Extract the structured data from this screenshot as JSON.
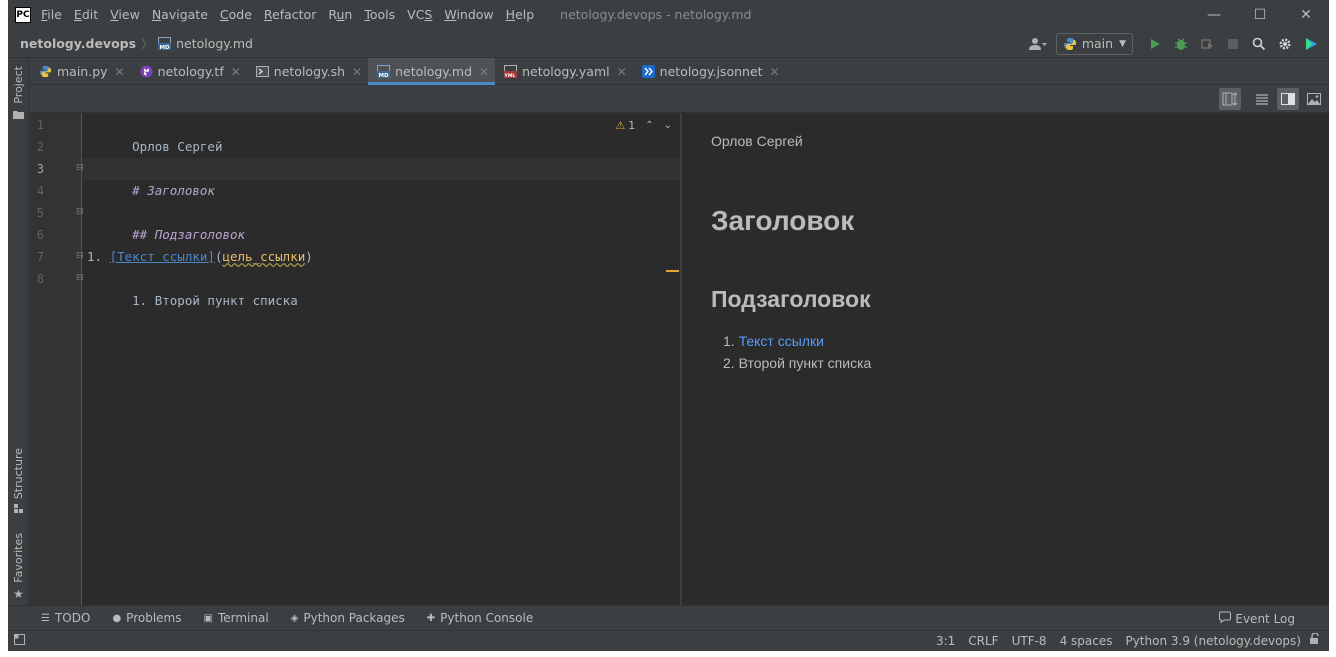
{
  "titlebar": {
    "logo": "PC",
    "menu": [
      {
        "pre": "",
        "u": "F",
        "post": "ile"
      },
      {
        "pre": "",
        "u": "E",
        "post": "dit"
      },
      {
        "pre": "",
        "u": "V",
        "post": "iew"
      },
      {
        "pre": "",
        "u": "N",
        "post": "avigate"
      },
      {
        "pre": "",
        "u": "C",
        "post": "ode"
      },
      {
        "pre": "",
        "u": "R",
        "post": "efactor"
      },
      {
        "pre": "R",
        "u": "u",
        "post": "n"
      },
      {
        "pre": "",
        "u": "T",
        "post": "ools"
      },
      {
        "pre": "VC",
        "u": "S",
        "post": ""
      },
      {
        "pre": "",
        "u": "W",
        "post": "indow"
      },
      {
        "pre": "",
        "u": "H",
        "post": "elp"
      }
    ],
    "window_title": "netology.devops - netology.md",
    "controls": {
      "minimize": "—",
      "maximize": "☐",
      "close": "✕"
    }
  },
  "navbar": {
    "project": "netology.devops",
    "separator": "〉",
    "file": "netology.md",
    "branch": "main"
  },
  "left_strip": {
    "project_label": "Project",
    "structure_label": "Structure",
    "favorites_label": "Favorites"
  },
  "tabs": [
    {
      "label": "main.py",
      "icon": "python-icon",
      "active": false
    },
    {
      "label": "netology.tf",
      "icon": "terraform-icon",
      "active": false
    },
    {
      "label": "netology.sh",
      "icon": "shell-icon",
      "active": false
    },
    {
      "label": "netology.md",
      "icon": "markdown-icon",
      "active": true
    },
    {
      "label": "netology.yaml",
      "icon": "yaml-icon",
      "active": false
    },
    {
      "label": "netology.jsonnet",
      "icon": "jsonnet-icon",
      "active": false
    }
  ],
  "editor": {
    "line_numbers": [
      "1",
      "2",
      "3",
      "4",
      "5",
      "6",
      "7",
      "8"
    ],
    "current_line": 3,
    "line1": "Орлов Сергей",
    "line3": "# Заголовок",
    "line5": "## Подзаголовок",
    "line7_prefix": "1. ",
    "line7_link_text": "[Текст ссылки]",
    "line7_paren_open": "(",
    "line7_url": "цель_ссылки",
    "line7_paren_close": ")",
    "line8": "1. Второй пункт списка",
    "warnings_count": "1"
  },
  "preview": {
    "author": "Орлов Сергей",
    "h1": "Заголовок",
    "h2": "Подзаголовок",
    "list": [
      {
        "num": "1.",
        "text": "Текст ссылки"
      },
      {
        "num": "2.",
        "text": "Второй пункт списка"
      }
    ]
  },
  "bottombar": {
    "todo": "TODO",
    "problems": "Problems",
    "terminal": "Terminal",
    "python_packages": "Python Packages",
    "python_console": "Python Console",
    "event_log": "Event Log"
  },
  "statusbar": {
    "position": "3:1",
    "line_sep": "CRLF",
    "encoding": "UTF-8",
    "indent": "4 spaces",
    "interpreter": "Python 3.9 (netology.devops)"
  },
  "colors": {
    "accent": "#4a88c7",
    "warning": "#e0a63b",
    "link": "#589df6",
    "heading_md": "#b9a5d1"
  }
}
